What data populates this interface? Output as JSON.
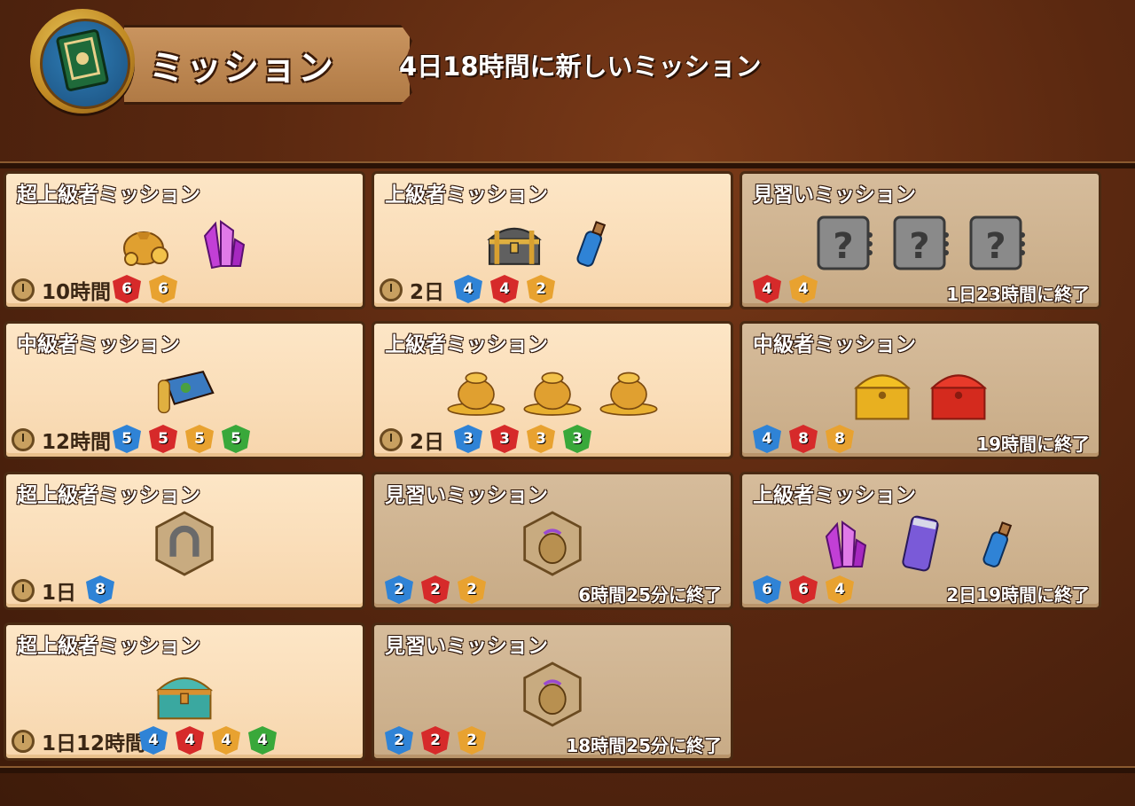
{
  "header": {
    "title": "ミッション",
    "refresh_text": "4日18時間に新しいミッション",
    "icon": "book-icon"
  },
  "colors": {
    "background": "#5a2810",
    "card_active": "#fde6c6",
    "card_done": "#d6bc9b",
    "blue": "#2f83d6",
    "red": "#d62a2a",
    "orange": "#e8a230",
    "green": "#39a83a"
  },
  "cards": [
    {
      "title": "超上級者ミッション",
      "rewards": [
        "gold-bag-icon",
        "purple-crystal-icon"
      ],
      "duration": "10時間",
      "counts": [
        {
          "c": "red",
          "n": "6"
        },
        {
          "c": "orange",
          "n": "6"
        }
      ],
      "ends": "",
      "done": false
    },
    {
      "title": "上級者ミッション",
      "rewards": [
        "treasure-chest-icon",
        "blue-potion-icon"
      ],
      "duration": "2日",
      "counts": [
        {
          "c": "blue",
          "n": "4"
        },
        {
          "c": "red",
          "n": "4"
        },
        {
          "c": "orange",
          "n": "2"
        }
      ],
      "ends": "",
      "done": false
    },
    {
      "title": "見習いミッション",
      "rewards": [
        "mystery-box-icon",
        "mystery-box-icon",
        "mystery-box-icon"
      ],
      "duration": "",
      "counts": [
        {
          "c": "red",
          "n": "4"
        },
        {
          "c": "orange",
          "n": "4"
        }
      ],
      "ends": "1日23時間に終了",
      "done": true
    },
    {
      "title": "中級者ミッション",
      "rewards": [
        "treasure-map-icon"
      ],
      "duration": "12時間",
      "counts": [
        {
          "c": "blue",
          "n": "5"
        },
        {
          "c": "red",
          "n": "5"
        },
        {
          "c": "orange",
          "n": "5"
        },
        {
          "c": "green",
          "n": "5"
        }
      ],
      "ends": "",
      "done": false
    },
    {
      "title": "上級者ミッション",
      "rewards": [
        "gold-pile-icon",
        "gold-pile-icon",
        "gold-pile-icon"
      ],
      "duration": "2日",
      "counts": [
        {
          "c": "blue",
          "n": "3"
        },
        {
          "c": "red",
          "n": "3"
        },
        {
          "c": "orange",
          "n": "3"
        },
        {
          "c": "green",
          "n": "3"
        }
      ],
      "ends": "",
      "done": false
    },
    {
      "title": "中級者ミッション",
      "rewards": [
        "gold-chest-icon",
        "ruby-chest-icon"
      ],
      "duration": "",
      "counts": [
        {
          "c": "blue",
          "n": "4"
        },
        {
          "c": "red",
          "n": "8"
        },
        {
          "c": "orange",
          "n": "8"
        }
      ],
      "ends": "19時間に終了",
      "done": true
    },
    {
      "title": "超上級者ミッション",
      "rewards": [
        "horseshoe-icon"
      ],
      "duration": "1日",
      "counts": [
        {
          "c": "blue",
          "n": "8"
        }
      ],
      "ends": "",
      "done": false
    },
    {
      "title": "見習いミッション",
      "rewards": [
        "item-bag-icon"
      ],
      "duration": "",
      "counts": [
        {
          "c": "blue",
          "n": "2"
        },
        {
          "c": "red",
          "n": "2"
        },
        {
          "c": "orange",
          "n": "2"
        }
      ],
      "ends": "6時間25分に終了",
      "done": true
    },
    {
      "title": "上級者ミッション",
      "rewards": [
        "purple-crystal-icon",
        "energy-can-icon",
        "blue-potion-icon"
      ],
      "duration": "",
      "counts": [
        {
          "c": "blue",
          "n": "6"
        },
        {
          "c": "red",
          "n": "6"
        },
        {
          "c": "orange",
          "n": "4"
        }
      ],
      "ends": "2日19時間に終了",
      "done": true
    },
    {
      "title": "超上級者ミッション",
      "rewards": [
        "teal-chest-icon"
      ],
      "duration": "1日12時間",
      "counts": [
        {
          "c": "blue",
          "n": "4"
        },
        {
          "c": "red",
          "n": "4"
        },
        {
          "c": "orange",
          "n": "4"
        },
        {
          "c": "green",
          "n": "4"
        }
      ],
      "ends": "",
      "done": false
    },
    {
      "title": "見習いミッション",
      "rewards": [
        "item-bag-icon"
      ],
      "duration": "",
      "counts": [
        {
          "c": "blue",
          "n": "2"
        },
        {
          "c": "red",
          "n": "2"
        },
        {
          "c": "orange",
          "n": "2"
        }
      ],
      "ends": "18時間25分に終了",
      "done": true
    }
  ]
}
